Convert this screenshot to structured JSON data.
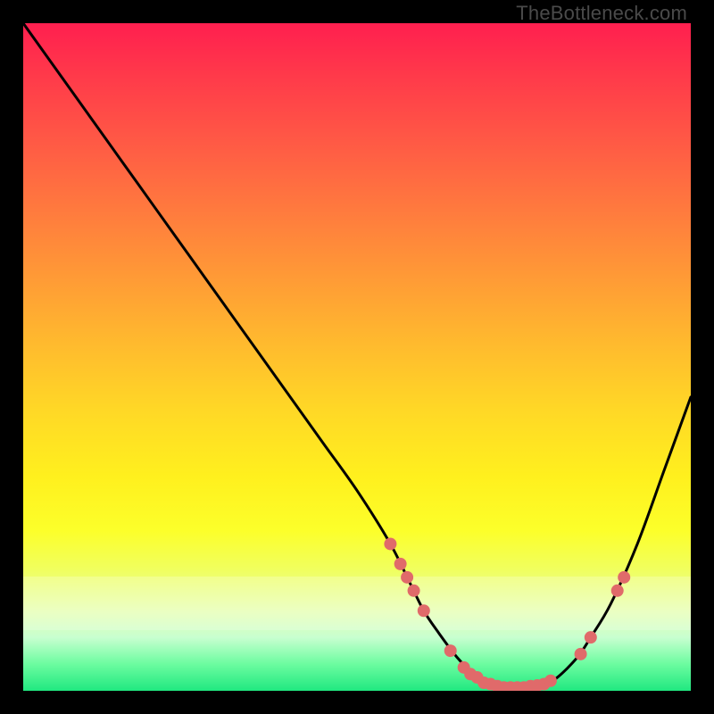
{
  "watermark": "TheBottleneck.com",
  "colors": {
    "curve": "#000000",
    "marker_fill": "#e06a6a",
    "marker_stroke": "#c94d4d",
    "frame_bg": "#000000"
  },
  "chart_data": {
    "type": "line",
    "title": "",
    "xlabel": "",
    "ylabel": "",
    "xlim": [
      0,
      100
    ],
    "ylim": [
      0,
      100
    ],
    "grid": false,
    "legend": false,
    "series": [
      {
        "name": "bottleneck-curve",
        "x": [
          0,
          5,
          10,
          15,
          20,
          25,
          30,
          35,
          40,
          45,
          50,
          55,
          58,
          60,
          62,
          65,
          68,
          70,
          72,
          75,
          78,
          80,
          83,
          85,
          88,
          92,
          96,
          100
        ],
        "y": [
          100,
          93,
          86,
          79,
          72,
          65,
          58,
          51,
          44,
          37,
          30,
          22,
          16,
          12,
          9,
          5,
          2,
          1,
          0.5,
          0.5,
          1,
          2,
          5,
          8,
          13,
          22,
          33,
          44
        ]
      }
    ],
    "markers": [
      {
        "x": 55.0,
        "y": 22.0
      },
      {
        "x": 56.5,
        "y": 19.0
      },
      {
        "x": 57.5,
        "y": 17.0
      },
      {
        "x": 58.5,
        "y": 15.0
      },
      {
        "x": 60.0,
        "y": 12.0
      },
      {
        "x": 64.0,
        "y": 6.0
      },
      {
        "x": 66.0,
        "y": 3.5
      },
      {
        "x": 67.0,
        "y": 2.5
      },
      {
        "x": 68.0,
        "y": 2.0
      },
      {
        "x": 69.0,
        "y": 1.2
      },
      {
        "x": 70.0,
        "y": 1.0
      },
      {
        "x": 71.0,
        "y": 0.7
      },
      {
        "x": 72.0,
        "y": 0.5
      },
      {
        "x": 73.0,
        "y": 0.5
      },
      {
        "x": 74.0,
        "y": 0.5
      },
      {
        "x": 75.0,
        "y": 0.5
      },
      {
        "x": 76.0,
        "y": 0.7
      },
      {
        "x": 77.0,
        "y": 0.8
      },
      {
        "x": 78.0,
        "y": 1.0
      },
      {
        "x": 79.0,
        "y": 1.5
      },
      {
        "x": 83.5,
        "y": 5.5
      },
      {
        "x": 85.0,
        "y": 8.0
      },
      {
        "x": 89.0,
        "y": 15.0
      },
      {
        "x": 90.0,
        "y": 17.0
      }
    ],
    "marker_radius": 7
  }
}
